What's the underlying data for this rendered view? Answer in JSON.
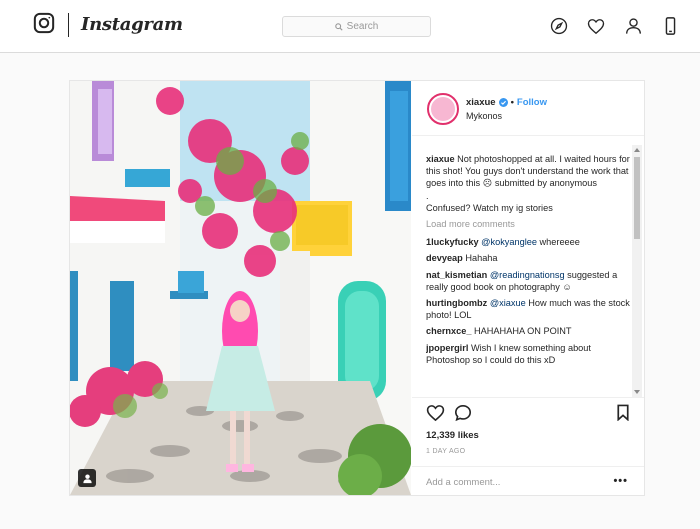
{
  "topbar": {
    "logo_text": "Instagram",
    "search_placeholder": "Search",
    "icons": [
      "instagram-glyph-icon",
      "compass-icon",
      "heart-icon",
      "profile-icon",
      "mobile-icon"
    ]
  },
  "post": {
    "username": "xiaxue",
    "verified": true,
    "separator": "•",
    "follow_label": "Follow",
    "location": "Mykonos",
    "caption": {
      "user": "xiaxue",
      "text": "Not photoshopped at all. I waited hours for this shot! You guys don't understand the work that goes into this ☹ submitted by anonymous",
      "line2": ".",
      "line3": "Confused? Watch my ig stories"
    },
    "load_more": "Load more comments",
    "comments": [
      {
        "user": "1luckyfucky",
        "mention": "@kokyanglee",
        "text": " whereeee"
      },
      {
        "user": "devyeap",
        "mention": "",
        "text": "Hahaha"
      },
      {
        "user": "nat_kismetian",
        "mention": "@readingnationsg",
        "text": " suggested a really good book on photography ☺"
      },
      {
        "user": "hurtingbombz",
        "mention": "@xiaxue",
        "text": " How much was the stock photo! LOL"
      },
      {
        "user": "chernxce_",
        "mention": "",
        "text": "HAHAHAHA ON POINT"
      },
      {
        "user": "jpopergirl",
        "mention": "",
        "text": "Wish I knew something about Photoshop so I could do this xD"
      }
    ],
    "likes": "12,339 likes",
    "time": "1 DAY AGO",
    "comment_placeholder": "Add a comment...",
    "more_label": "•••"
  },
  "colors": {
    "accent": "#3897f0",
    "border": "#dbdbdb",
    "text": "#262626",
    "muted": "#999999"
  }
}
